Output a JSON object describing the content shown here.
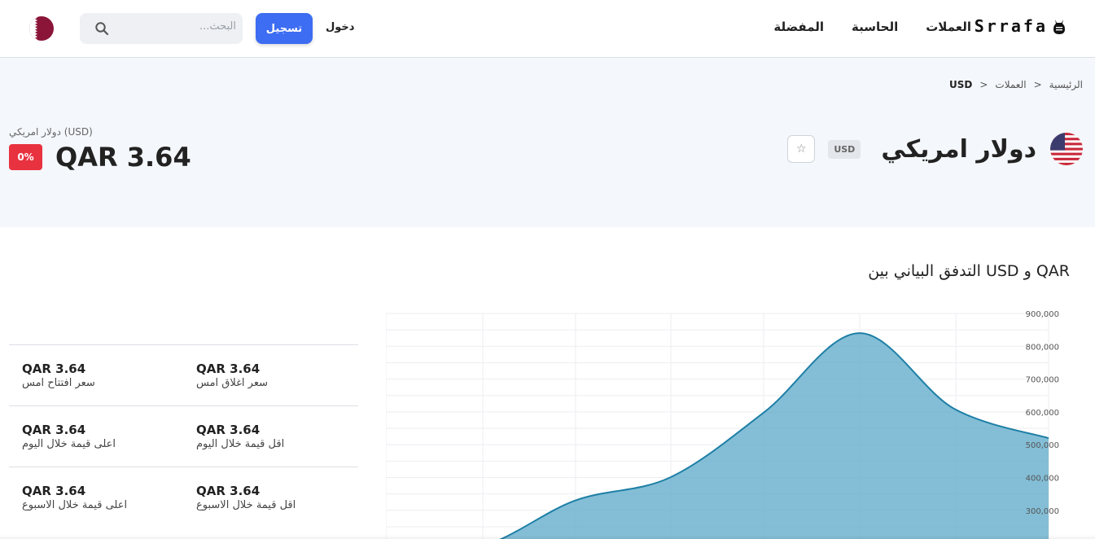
{
  "header": {
    "brand": "Srrafa",
    "nav": [
      "العملات",
      "الحاسبة",
      "المفضلة"
    ],
    "login_label": "دخول",
    "register_label": "تسجيل",
    "search_placeholder": "البحث..."
  },
  "breadcrumb": [
    "الرئيسية",
    ">",
    "العملات",
    ">",
    "USD"
  ],
  "currency": {
    "name": "دولار امريكي",
    "code": "USD",
    "subtitle": "دولار امريكي (USD)",
    "rate": "QAR 3.64",
    "change": "0%"
  },
  "chart_title": "التدفق البياني بين USD و QAR",
  "chart_data": {
    "type": "area",
    "ylim": [
      200000,
      900000
    ],
    "yticks": [
      "900,000",
      "800,000",
      "700,000",
      "600,000",
      "500,000",
      "400,000",
      "300,000"
    ],
    "y_tick_values": [
      900000,
      800000,
      700000,
      600000,
      500000,
      400000,
      300000
    ],
    "x": [
      0,
      1,
      2,
      3,
      4,
      5,
      6,
      7
    ],
    "values": [
      190000,
      190000,
      330000,
      400000,
      600000,
      840000,
      610000,
      520000
    ],
    "color": "#5ba8c8",
    "line_color": "#1e7fa6"
  },
  "stats": [
    {
      "a_value": "QAR 3.64",
      "a_label": "سعر افتتاح امس",
      "b_value": "QAR 3.64",
      "b_label": "سعر اغلاق امس"
    },
    {
      "a_value": "QAR 3.64",
      "a_label": "اعلى قيمة خلال اليوم",
      "b_value": "QAR 3.64",
      "b_label": "اقل قيمة خلال اليوم"
    },
    {
      "a_value": "QAR 3.64",
      "a_label": "اعلى قيمة خلال الاسبوع",
      "b_value": "QAR 3.64",
      "b_label": "اقل قيمة خلال الاسبوع"
    }
  ],
  "colors": {
    "accent": "#3d6df2",
    "negative": "#e8323f",
    "hero_bg": "#f4f7fb"
  }
}
